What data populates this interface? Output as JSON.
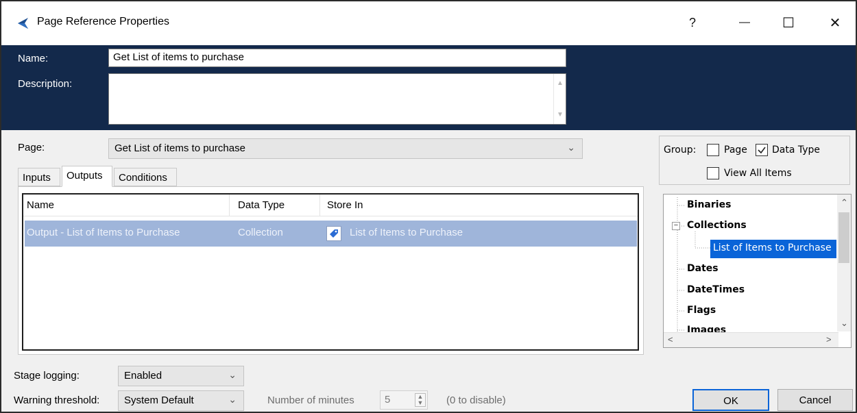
{
  "window": {
    "title": "Page Reference Properties",
    "help_glyph": "?",
    "minimize_glyph": "—",
    "maximize_glyph": "☐",
    "close_glyph": "✕"
  },
  "header": {
    "name_label": "Name:",
    "name_value": "Get List of items to purchase",
    "description_label": "Description:",
    "description_value": ""
  },
  "page": {
    "label": "Page:",
    "selected": "Get List of items to purchase"
  },
  "tabs": [
    {
      "label": "Inputs"
    },
    {
      "label": "Outputs"
    },
    {
      "label": "Conditions"
    }
  ],
  "active_tab": "Outputs",
  "grid": {
    "columns": [
      "Name",
      "Data Type",
      "Store In"
    ],
    "rows": [
      {
        "name": "Output - List of Items to Purchase",
        "data_type": "Collection",
        "store_in": "List of Items to Purchase"
      }
    ]
  },
  "group": {
    "label": "Group:",
    "page_label": "Page",
    "page_checked": false,
    "data_type_label": "Data Type",
    "data_type_checked": true,
    "view_all_label": "View All Items",
    "view_all_checked": false
  },
  "tree": {
    "items": [
      {
        "label": "Binaries"
      },
      {
        "label": "Collections",
        "expanded": true
      },
      {
        "label": "List of Items to Purchase",
        "selected": true
      },
      {
        "label": "Dates"
      },
      {
        "label": "DateTimes"
      },
      {
        "label": "Flags"
      },
      {
        "label": "Images"
      }
    ],
    "expand_glyph": "−"
  },
  "bottom": {
    "stage_logging_label": "Stage logging:",
    "stage_logging_value": "Enabled",
    "warning_threshold_label": "Warning threshold:",
    "warning_threshold_value": "System Default",
    "minutes_label": "Number of minutes",
    "minutes_value": "5",
    "disable_hint": "(0 to disable)",
    "ok_label": "OK",
    "cancel_label": "Cancel"
  },
  "colors": {
    "header_bg": "#13294b",
    "selected_row": "#9fb5da",
    "tree_selection": "#0a64d8"
  }
}
